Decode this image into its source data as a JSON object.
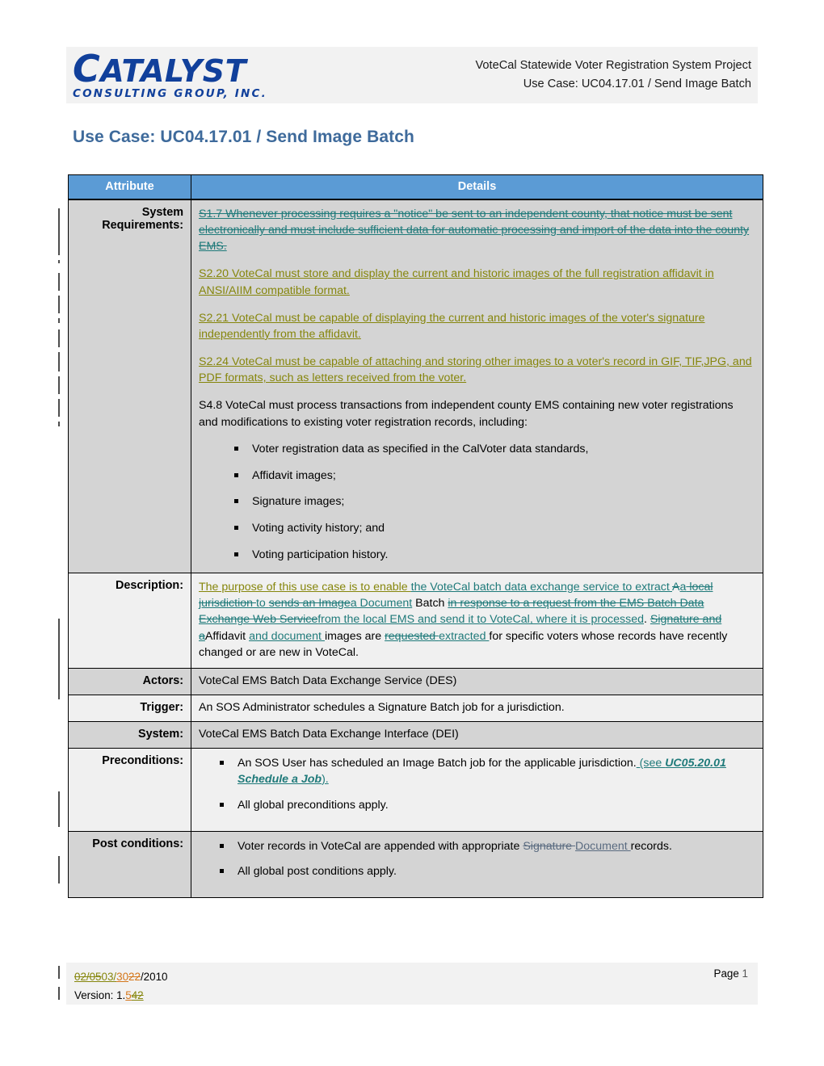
{
  "header": {
    "logo_main": "ATALYST",
    "logo_main_cap": "C",
    "logo_sub": "CONSULTING GROUP, INC.",
    "project_line": "VoteCal Statewide Voter Registration System Project",
    "usecase_line": "Use Case: UC04.17.01 / Send Image Batch"
  },
  "page_title": "Use Case: UC04.17.01 / Send Image Batch",
  "table": {
    "columns": [
      "Attribute",
      "Details"
    ],
    "rows": [
      {
        "attribute": "System Requirements:",
        "req_s17": "S1.7 Whenever processing requires a \"notice\" be sent to an independent county, that notice must be sent electronically and must include sufficient data for automatic processing and import of the data into the county EMS.",
        "req_s220": "S2.20 VoteCal must store and display the current and historic images of the full registration affidavit in ANSI/AIIM compatible format.",
        "req_s221": "S2.21 VoteCal must be capable of displaying the current and historic images of the voter's signature independently from the affidavit.",
        "req_s224": "S2.24 VoteCal must be capable of attaching and storing other images to a voter's record in GIF, TIF,JPG, and PDF formats, such as letters received from the voter.",
        "req_s48": "S4.8 VoteCal must process transactions from independent county EMS containing new voter registrations and modifications to existing voter registration records, including:",
        "bullets": [
          "Voter registration data as specified in the CalVoter data standards,",
          "Affidavit images;",
          "Signature images;",
          "Voting activity history; and",
          "Voting participation history."
        ]
      },
      {
        "attribute": "Description:",
        "runs": [
          {
            "text": "The purpose of this use case is to enable ",
            "style": "ins-olive"
          },
          {
            "text": "the VoteCal batch data exchange service to extract ",
            "style": "ins-teal"
          },
          {
            "text": "A",
            "style": "del-teal-only"
          },
          {
            "text": "a",
            "style": "ins-teal"
          },
          {
            "text": " local jurisdiction ",
            "style": "del-teal"
          },
          {
            "text": "to ",
            "style": "ins-teal"
          },
          {
            "text": "sends an Image",
            "style": "del-teal"
          },
          {
            "text": "a Document",
            "style": "ins-teal"
          },
          {
            "text": " Batch ",
            "style": "plain"
          },
          {
            "text": "in response to a request from the EMS Batch Data Exchange Web Service",
            "style": "del-teal"
          },
          {
            "text": "from the local EMS and send it to VoteCal, where it is processed",
            "style": "ins-teal"
          },
          {
            "text": ". ",
            "style": "plain"
          },
          {
            "text": "Signature and a",
            "style": "del-teal"
          },
          {
            "text": "A",
            "style": "plain"
          },
          {
            "text": "ffidavit ",
            "style": "plain"
          },
          {
            "text": "and document ",
            "style": "ins-teal"
          },
          {
            "text": "images are ",
            "style": "plain"
          },
          {
            "text": "requested ",
            "style": "del-teal"
          },
          {
            "text": "extracted ",
            "style": "ins-teal"
          },
          {
            "text": "for specific voters whose records have recently changed or are new in VoteCal.",
            "style": "plain"
          }
        ]
      },
      {
        "attribute": "Actors:",
        "value": "VoteCal EMS Batch Data Exchange Service (DES)"
      },
      {
        "attribute": "Trigger:",
        "value": "An SOS Administrator schedules a Signature Batch job for a jurisdiction."
      },
      {
        "attribute": "System:",
        "value": "VoteCal EMS Batch Data Exchange Interface (DEI)"
      },
      {
        "attribute": "Preconditions:",
        "bullet1_plain": "An SOS User has scheduled an Image Batch job for the applicable jurisdiction.",
        "bullet1_ins_see": " (see ",
        "bullet1_ins_ref": "UC05.20.01 Schedule a Job",
        "bullet1_ins_close": ").",
        "bullet2": "All global preconditions apply."
      },
      {
        "attribute": "Post conditions:",
        "bullet1_plain": "Voter records in VoteCal are appended with appropriate ",
        "bullet1_del": "Signature ",
        "bullet1_ins": "Document ",
        "bullet1_tail": "records.",
        "bullet2": "All global post conditions apply."
      }
    ]
  },
  "footer": {
    "date_del_1": "02/05",
    "date_ins_1": "03/",
    "date_ins_2": "30",
    "date_del_2": "22",
    "date_tail": "/2010",
    "version_label": "Version: 1.",
    "version_ins": "5",
    "version_del": "42",
    "page_label": "Page ",
    "page_number": "1"
  },
  "colors": {
    "header_blue": "#5b9bd5",
    "title_blue": "#3e6a9b",
    "logo_blue": "#11409b",
    "insert_teal": "#1f7a7a",
    "insert_olive": "#86860c",
    "insert_orange": "#d4761a",
    "row_dark": "#d4d4d4",
    "row_light": "#f0f0f0"
  }
}
